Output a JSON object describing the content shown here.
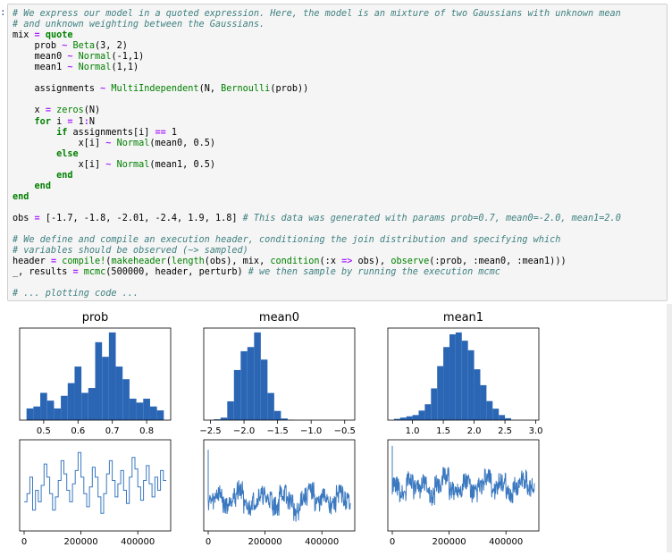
{
  "cell": {
    "prompt_mark": ":",
    "lines": [
      [
        [
          "c",
          "# We express our model in a quoted expression. Here, the model is an mixture of two Gaussians with unknown mean"
        ]
      ],
      [
        [
          "c",
          "# and unknown weighting between the Gaussians."
        ]
      ],
      [
        [
          "t",
          "mix "
        ],
        [
          "o",
          "="
        ],
        [
          "t",
          " "
        ],
        [
          "k",
          "quote"
        ]
      ],
      [
        [
          "t",
          "    prob "
        ],
        [
          "o",
          "~"
        ],
        [
          "t",
          " "
        ],
        [
          "f",
          "Beta"
        ],
        [
          "t",
          "(3, 2)"
        ]
      ],
      [
        [
          "t",
          "    mean0 "
        ],
        [
          "o",
          "~"
        ],
        [
          "t",
          " "
        ],
        [
          "f",
          "Normal"
        ],
        [
          "t",
          "(-1,1)"
        ]
      ],
      [
        [
          "t",
          "    mean1 "
        ],
        [
          "o",
          "~"
        ],
        [
          "t",
          " "
        ],
        [
          "f",
          "Normal"
        ],
        [
          "t",
          "(1,1)"
        ]
      ],
      [],
      [
        [
          "t",
          "    assignments "
        ],
        [
          "o",
          "~"
        ],
        [
          "t",
          " "
        ],
        [
          "f",
          "MultiIndependent"
        ],
        [
          "t",
          "(N, "
        ],
        [
          "f",
          "Bernoulli"
        ],
        [
          "t",
          "(prob))"
        ]
      ],
      [],
      [
        [
          "t",
          "    x "
        ],
        [
          "o",
          "="
        ],
        [
          "t",
          " "
        ],
        [
          "f",
          "zeros"
        ],
        [
          "t",
          "(N)"
        ]
      ],
      [
        [
          "t",
          "    "
        ],
        [
          "k",
          "for"
        ],
        [
          "t",
          " i "
        ],
        [
          "o",
          "="
        ],
        [
          "t",
          " 1"
        ],
        [
          "o",
          ":"
        ],
        [
          "t",
          "N"
        ]
      ],
      [
        [
          "t",
          "        "
        ],
        [
          "k",
          "if"
        ],
        [
          "t",
          " assignments[i] "
        ],
        [
          "o",
          "=="
        ],
        [
          "t",
          " 1"
        ]
      ],
      [
        [
          "t",
          "            x[i] "
        ],
        [
          "o",
          "~"
        ],
        [
          "t",
          " "
        ],
        [
          "f",
          "Normal"
        ],
        [
          "t",
          "(mean0, 0.5)"
        ]
      ],
      [
        [
          "t",
          "        "
        ],
        [
          "k",
          "else"
        ]
      ],
      [
        [
          "t",
          "            x[i] "
        ],
        [
          "o",
          "~"
        ],
        [
          "t",
          " "
        ],
        [
          "f",
          "Normal"
        ],
        [
          "t",
          "(mean1, 0.5)"
        ]
      ],
      [
        [
          "t",
          "        "
        ],
        [
          "k",
          "end"
        ]
      ],
      [
        [
          "t",
          "    "
        ],
        [
          "k",
          "end"
        ]
      ],
      [
        [
          "k",
          "end"
        ]
      ],
      [],
      [
        [
          "t",
          "obs "
        ],
        [
          "o",
          "="
        ],
        [
          "t",
          " [-1.7, -1.8, -2.01, -2.4, 1.9, 1.8] "
        ],
        [
          "c",
          "# This data was generated with params prob=0.7, mean0=-2.0, mean1=2.0"
        ]
      ],
      [],
      [
        [
          "c",
          "# We define and compile an execution header, conditioning the join distribution and specifying which"
        ]
      ],
      [
        [
          "c",
          "# variables should be observed (~> sampled)"
        ]
      ],
      [
        [
          "t",
          "header "
        ],
        [
          "o",
          "="
        ],
        [
          "t",
          " "
        ],
        [
          "f",
          "compile!"
        ],
        [
          "t",
          "("
        ],
        [
          "f",
          "makeheader"
        ],
        [
          "t",
          "("
        ],
        [
          "f",
          "length"
        ],
        [
          "t",
          "(obs), mix, "
        ],
        [
          "f",
          "condition"
        ],
        [
          "t",
          "(:x "
        ],
        [
          "o",
          "=>"
        ],
        [
          "t",
          " obs), "
        ],
        [
          "f",
          "observe"
        ],
        [
          "t",
          "(:prob, :mean0, :mean1)))"
        ]
      ],
      [
        [
          "t",
          "_, results "
        ],
        [
          "o",
          "="
        ],
        [
          "t",
          " "
        ],
        [
          "f",
          "mcmc"
        ],
        [
          "t",
          "(500000, header, perturb) "
        ],
        [
          "c",
          "# we then sample by running the execution mcmc"
        ]
      ],
      [],
      [
        [
          "c",
          "# ... plotting code ..."
        ]
      ]
    ]
  },
  "colors": {
    "bar_fill": "#2b66b5",
    "trace_line": "#3a78c0",
    "axis": "#000000"
  },
  "chart_data": [
    {
      "type": "bar",
      "title": "prob",
      "histogram_bins": [
        {
          "from": 0.45,
          "to": 0.47,
          "count": 12
        },
        {
          "from": 0.47,
          "to": 0.49,
          "count": 14
        },
        {
          "from": 0.49,
          "to": 0.51,
          "count": 28
        },
        {
          "from": 0.51,
          "to": 0.53,
          "count": 20
        },
        {
          "from": 0.53,
          "to": 0.55,
          "count": 12
        },
        {
          "from": 0.55,
          "to": 0.57,
          "count": 25
        },
        {
          "from": 0.57,
          "to": 0.59,
          "count": 38
        },
        {
          "from": 0.59,
          "to": 0.61,
          "count": 55
        },
        {
          "from": 0.61,
          "to": 0.63,
          "count": 28
        },
        {
          "from": 0.63,
          "to": 0.65,
          "count": 33
        },
        {
          "from": 0.65,
          "to": 0.67,
          "count": 80
        },
        {
          "from": 0.67,
          "to": 0.69,
          "count": 65
        },
        {
          "from": 0.69,
          "to": 0.71,
          "count": 90
        },
        {
          "from": 0.71,
          "to": 0.73,
          "count": 55
        },
        {
          "from": 0.73,
          "to": 0.75,
          "count": 42
        },
        {
          "from": 0.75,
          "to": 0.77,
          "count": 22
        },
        {
          "from": 0.77,
          "to": 0.79,
          "count": 18
        },
        {
          "from": 0.79,
          "to": 0.81,
          "count": 22
        },
        {
          "from": 0.81,
          "to": 0.83,
          "count": 14
        },
        {
          "from": 0.83,
          "to": 0.85,
          "count": 10
        }
      ],
      "xlim": [
        0.43,
        0.87
      ],
      "x_ticks": [
        0.5,
        0.6,
        0.7,
        0.8
      ],
      "x_tick_labels": [
        "0.5",
        "0.6",
        "0.7",
        "0.8"
      ],
      "grid": false
    },
    {
      "type": "bar",
      "title": "mean0",
      "histogram_bins": [
        {
          "from": -2.45,
          "to": -2.35,
          "count": 2
        },
        {
          "from": -2.35,
          "to": -2.25,
          "count": 6
        },
        {
          "from": -2.25,
          "to": -2.15,
          "count": 45
        },
        {
          "from": -2.15,
          "to": -2.05,
          "count": 120
        },
        {
          "from": -2.05,
          "to": -1.95,
          "count": 165
        },
        {
          "from": -1.95,
          "to": -1.85,
          "count": 175
        },
        {
          "from": -1.85,
          "to": -1.75,
          "count": 210
        },
        {
          "from": -1.75,
          "to": -1.65,
          "count": 145
        },
        {
          "from": -1.65,
          "to": -1.55,
          "count": 65
        },
        {
          "from": -1.55,
          "to": -1.45,
          "count": 22
        },
        {
          "from": -1.45,
          "to": -1.35,
          "count": 4
        },
        {
          "from": -1.35,
          "to": -1.25,
          "count": 1
        }
      ],
      "xlim": [
        -2.6,
        -0.35
      ],
      "x_ticks": [
        -2.5,
        -2.0,
        -1.5,
        -1.0,
        -0.5
      ],
      "x_tick_labels": [
        "−2.5",
        "−2.0",
        "−1.5",
        "−1.0",
        "−0.5"
      ],
      "grid": false
    },
    {
      "type": "bar",
      "title": "mean1",
      "histogram_bins": [
        {
          "from": 0.7,
          "to": 0.8,
          "count": 2
        },
        {
          "from": 0.8,
          "to": 0.9,
          "count": 4
        },
        {
          "from": 0.9,
          "to": 1.0,
          "count": 6
        },
        {
          "from": 1.0,
          "to": 1.1,
          "count": 8
        },
        {
          "from": 1.1,
          "to": 1.2,
          "count": 15
        },
        {
          "from": 1.2,
          "to": 1.3,
          "count": 25
        },
        {
          "from": 1.3,
          "to": 1.4,
          "count": 50
        },
        {
          "from": 1.4,
          "to": 1.5,
          "count": 85
        },
        {
          "from": 1.5,
          "to": 1.6,
          "count": 115
        },
        {
          "from": 1.6,
          "to": 1.7,
          "count": 135
        },
        {
          "from": 1.7,
          "to": 1.8,
          "count": 138
        },
        {
          "from": 1.8,
          "to": 1.9,
          "count": 125
        },
        {
          "from": 1.9,
          "to": 2.0,
          "count": 110
        },
        {
          "from": 2.0,
          "to": 2.1,
          "count": 80
        },
        {
          "from": 2.1,
          "to": 2.2,
          "count": 55
        },
        {
          "from": 2.2,
          "to": 2.3,
          "count": 30
        },
        {
          "from": 2.3,
          "to": 2.4,
          "count": 18
        },
        {
          "from": 2.4,
          "to": 2.5,
          "count": 8
        },
        {
          "from": 2.5,
          "to": 2.6,
          "count": 3
        }
      ],
      "xlim": [
        0.6,
        3.05
      ],
      "x_ticks": [
        1.0,
        1.5,
        2.0,
        2.5,
        3.0
      ],
      "x_tick_labels": [
        "1.0",
        "1.5",
        "2.0",
        "2.5",
        "3.0"
      ],
      "grid": false
    },
    {
      "type": "line",
      "title": "",
      "trace_of": "prob",
      "x_range": [
        0,
        500000
      ],
      "ylim": [
        0.4,
        0.9
      ],
      "x_ticks": [
        0,
        200000,
        400000
      ],
      "x_tick_labels": [
        "0",
        "200000",
        "400000"
      ],
      "trace_style": "step",
      "y_levels": [
        0.55,
        0.6,
        0.7,
        0.5,
        0.62,
        0.55,
        0.65,
        0.78,
        0.7,
        0.6,
        0.5,
        0.58,
        0.68,
        0.8,
        0.72,
        0.62,
        0.55,
        0.66,
        0.74,
        0.85,
        0.7,
        0.6,
        0.52,
        0.64,
        0.76,
        0.7,
        0.58,
        0.48,
        0.6,
        0.72,
        0.8,
        0.68,
        0.58,
        0.66,
        0.74,
        0.62,
        0.54,
        0.7,
        0.82,
        0.75,
        0.64,
        0.56,
        0.68,
        0.77,
        0.66,
        0.58,
        0.7,
        0.62,
        0.74,
        0.68
      ],
      "grid": false
    },
    {
      "type": "line",
      "title": "",
      "trace_of": "mean0",
      "x_range": [
        0,
        500000
      ],
      "ylim": [
        -2.6,
        -0.35
      ],
      "x_ticks": [
        0,
        200000,
        400000
      ],
      "x_tick_labels": [
        "0",
        "200000",
        "400000"
      ],
      "trace_style": "noise",
      "initial_value": -0.5,
      "y_levels": [
        -1.9,
        -1.7,
        -2.0,
        -1.8,
        -1.6,
        -2.1,
        -1.9,
        -1.75,
        -1.85,
        -2.05,
        -1.7,
        -1.9,
        -2.2,
        -1.8,
        -1.65,
        -1.95,
        -1.8,
        -2.0,
        -1.7,
        -1.9
      ],
      "grid": false
    },
    {
      "type": "line",
      "title": "",
      "trace_of": "mean1",
      "x_range": [
        0,
        500000
      ],
      "ylim": [
        0.6,
        3.05
      ],
      "x_ticks": [
        0,
        200000,
        400000
      ],
      "x_tick_labels": [
        "0",
        "200000",
        "400000"
      ],
      "trace_style": "noise",
      "initial_value": 3.0,
      "y_levels": [
        1.8,
        1.6,
        2.0,
        1.7,
        1.9,
        1.5,
        1.85,
        2.1,
        1.65,
        1.75,
        1.95,
        1.6,
        1.8,
        2.05,
        1.7,
        1.9,
        1.55,
        1.8,
        2.0,
        1.75
      ],
      "grid": false
    }
  ]
}
